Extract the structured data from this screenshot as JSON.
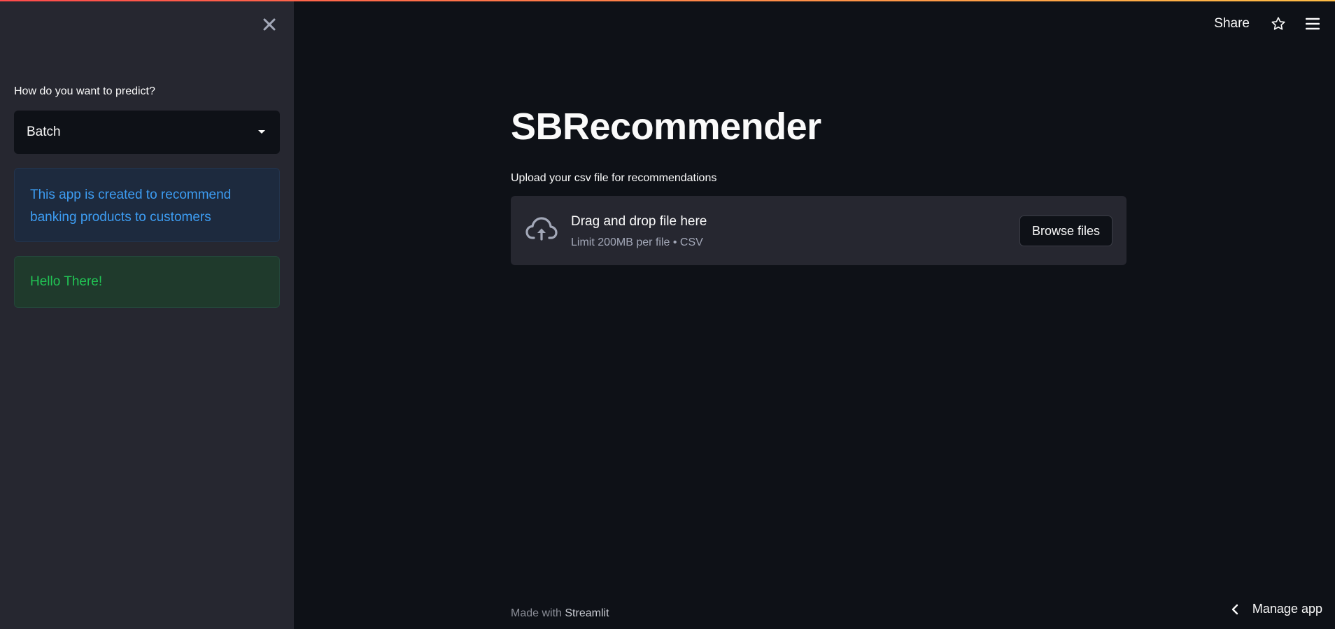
{
  "header": {
    "share_label": "Share",
    "star_icon": "star-icon",
    "menu_icon": "hamburger-menu-icon",
    "accent_gradient": [
      "#ff4b4b",
      "#ffbd45"
    ]
  },
  "sidebar": {
    "close_icon": "close-icon",
    "select_label": "How do you want to predict?",
    "select_value": "Batch",
    "info_text": "This app is created to recommend banking products to customers",
    "success_text": "Hello There!"
  },
  "main": {
    "title": "SBRecommender",
    "uploader_label": "Upload your csv file for recommendations",
    "drag_text": "Drag and drop file here",
    "limit_text": "Limit 200MB per file • CSV",
    "browse_label": "Browse files",
    "upload_icon": "cloud-upload-icon"
  },
  "footer": {
    "made_with": "Made with",
    "streamlit": "Streamlit",
    "manage_app": "Manage app"
  },
  "colors": {
    "background": "#0e1117",
    "sidebar": "#262730",
    "info_text": "#3d9df3",
    "success_text": "#21c354"
  }
}
